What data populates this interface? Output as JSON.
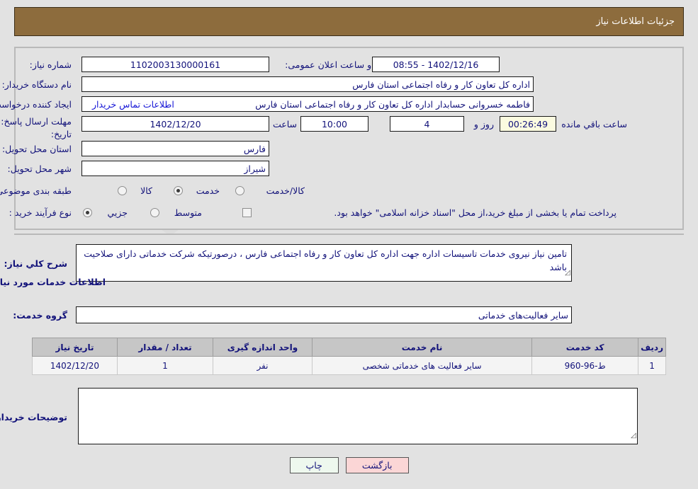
{
  "header": {
    "title": "جزئیات اطلاعات نیاز"
  },
  "form": {
    "need_number_label": "شماره نیاز:",
    "need_number_value": "1102003130000161",
    "announce_label": "تاریخ و ساعت اعلان عمومی:",
    "announce_value": "1402/12/16 - 08:55",
    "buyer_org_label": "نام دستگاه خریدار:",
    "buyer_org_value": "اداره کل تعاون  کار و رفاه اجتماعی استان فارس",
    "creator_label": "ایجاد کننده درخواست:",
    "creator_value": "فاطمه خسروانی حسابدار اداره کل تعاون  کار و رفاه اجتماعی استان فارس",
    "contact_link": "اطلاعات تماس خریدار",
    "deadline_label_1": "مهلت ارسال پاسخ: تا",
    "deadline_label_2": "تاریخ:",
    "deadline_date": "1402/12/20",
    "hour_label": "ساعت",
    "deadline_time": "10:00",
    "days_value": "4",
    "days_label": "روز و",
    "countdown": "00:26:49",
    "countdown_label": "ساعت باقي مانده",
    "province_label": "استان محل تحویل:",
    "province_value": "فارس",
    "city_label": "شهر محل تحویل:",
    "city_value": "شیراز",
    "category_label": "طبقه بندی موضوعی:",
    "category_options": [
      "کالا",
      "خدمت",
      "کالا/خدمت"
    ],
    "category_selected": "خدمت",
    "process_label": "نوع فرآیند خرید :",
    "process_options": [
      "جزیي",
      "متوسط"
    ],
    "process_selected": "جزیي",
    "treasury_note": "پرداخت تمام یا بخشی از مبلغ خرید،از محل \"اسناد خزانه اسلامی\" خواهد بود."
  },
  "description": {
    "label": "شرح کلي نیاز:",
    "value": "تامین نیاز نیروی  خدمات تاسیسات اداره جهت اداره کل تعاون کار و رفاه اجتماعی فارس ، درصورتیکه شرکت خدماتی دارای صلاحیت باشد"
  },
  "services_section": {
    "heading": "اطلاعات خدمات مورد نیاز",
    "group_label": "گروه خدمت:",
    "group_value": "سایر فعالیت‌های خدماتی"
  },
  "table": {
    "columns": [
      "ردیف",
      "کد خدمت",
      "نام خدمت",
      "واحد اندازه گیری",
      "تعداد / مقدار",
      "تاریخ نیاز"
    ],
    "rows": [
      {
        "row": "1",
        "code": "ط-96-960",
        "name": "سایر فعالیت های خدماتی شخصی",
        "unit": "نفر",
        "qty": "1",
        "date": "1402/12/20"
      }
    ]
  },
  "comments": {
    "label": "توضیحات خریدار;",
    "value": ""
  },
  "footer": {
    "print_label": "چاپ",
    "back_label": "بازگشت"
  },
  "watermark": {
    "text": "AriaTender.net"
  },
  "colors": {
    "header_bg": "#8d6c3d",
    "label_text": "#12127a",
    "link": "#1414d6",
    "timer_bg": "#fbfbe0",
    "table_header_bg": "#c6c6c6",
    "print_btn_bg": "#eef8ee",
    "back_btn_bg": "#fbd6d6"
  }
}
